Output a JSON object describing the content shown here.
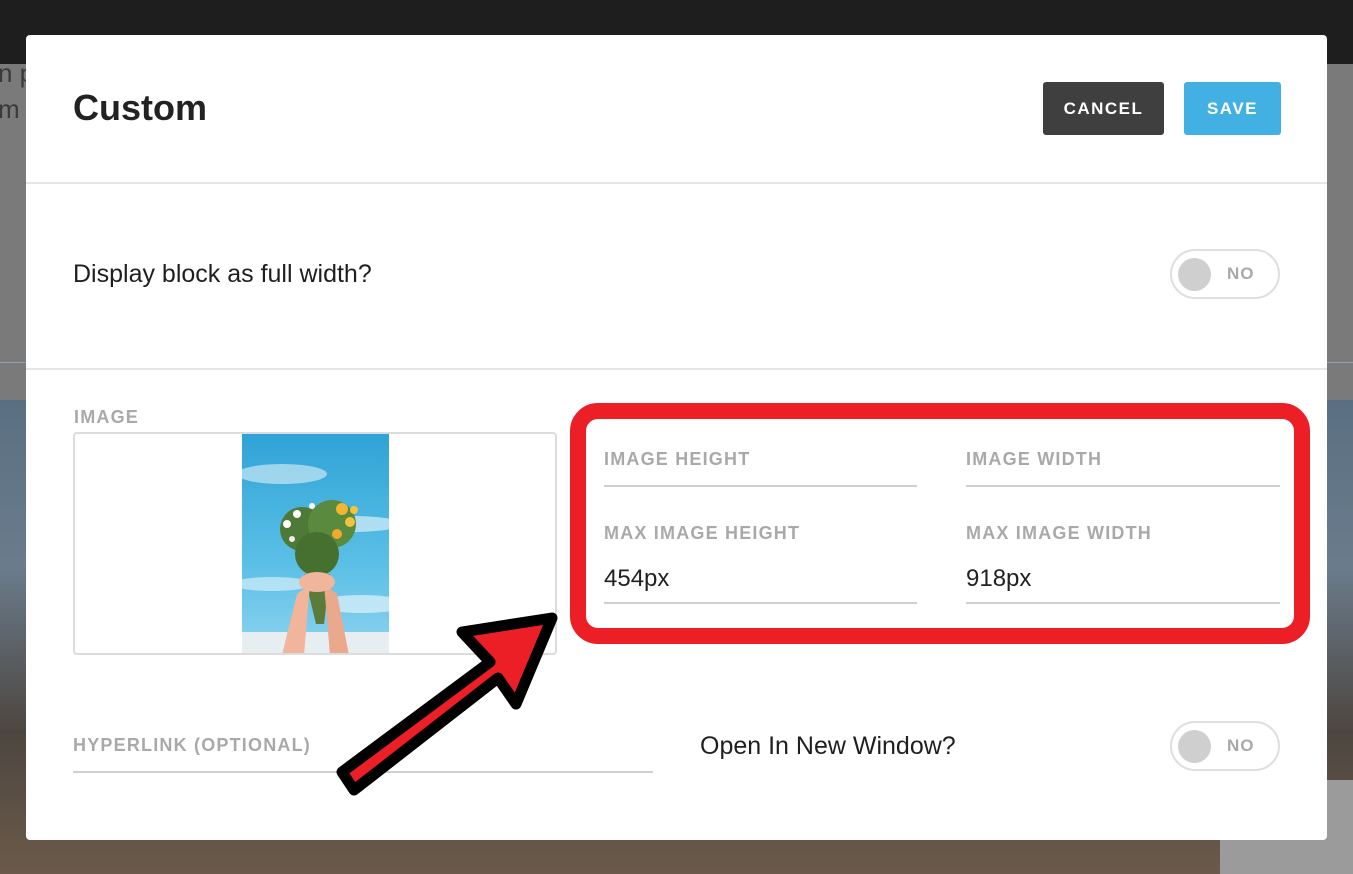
{
  "background": {
    "text_line_1": "n p",
    "text_line_2": "m"
  },
  "modal": {
    "title": "Custom",
    "cancel_label": "CANCEL",
    "save_label": "SAVE",
    "full_width": {
      "label": "Display block as full width?",
      "toggle_text": "NO"
    },
    "image_label": "IMAGE",
    "image_height": {
      "label": "IMAGE HEIGHT",
      "value": ""
    },
    "image_width": {
      "label": "IMAGE WIDTH",
      "value": ""
    },
    "max_image_height": {
      "label": "MAX IMAGE HEIGHT",
      "value": "454px"
    },
    "max_image_width": {
      "label": "MAX IMAGE WIDTH",
      "value": "918px"
    },
    "hyperlink": {
      "label": "HYPERLINK (OPTIONAL)",
      "value": ""
    },
    "new_window": {
      "label": "Open In New Window?",
      "toggle_text": "NO"
    }
  },
  "colors": {
    "save": "#42b0e3",
    "cancel": "#3f3f3f",
    "highlight": "#ec1f26"
  },
  "icons": {
    "annotation_arrow": "red-arrow-icon",
    "thumbnail": "flower-bouquet-image"
  }
}
